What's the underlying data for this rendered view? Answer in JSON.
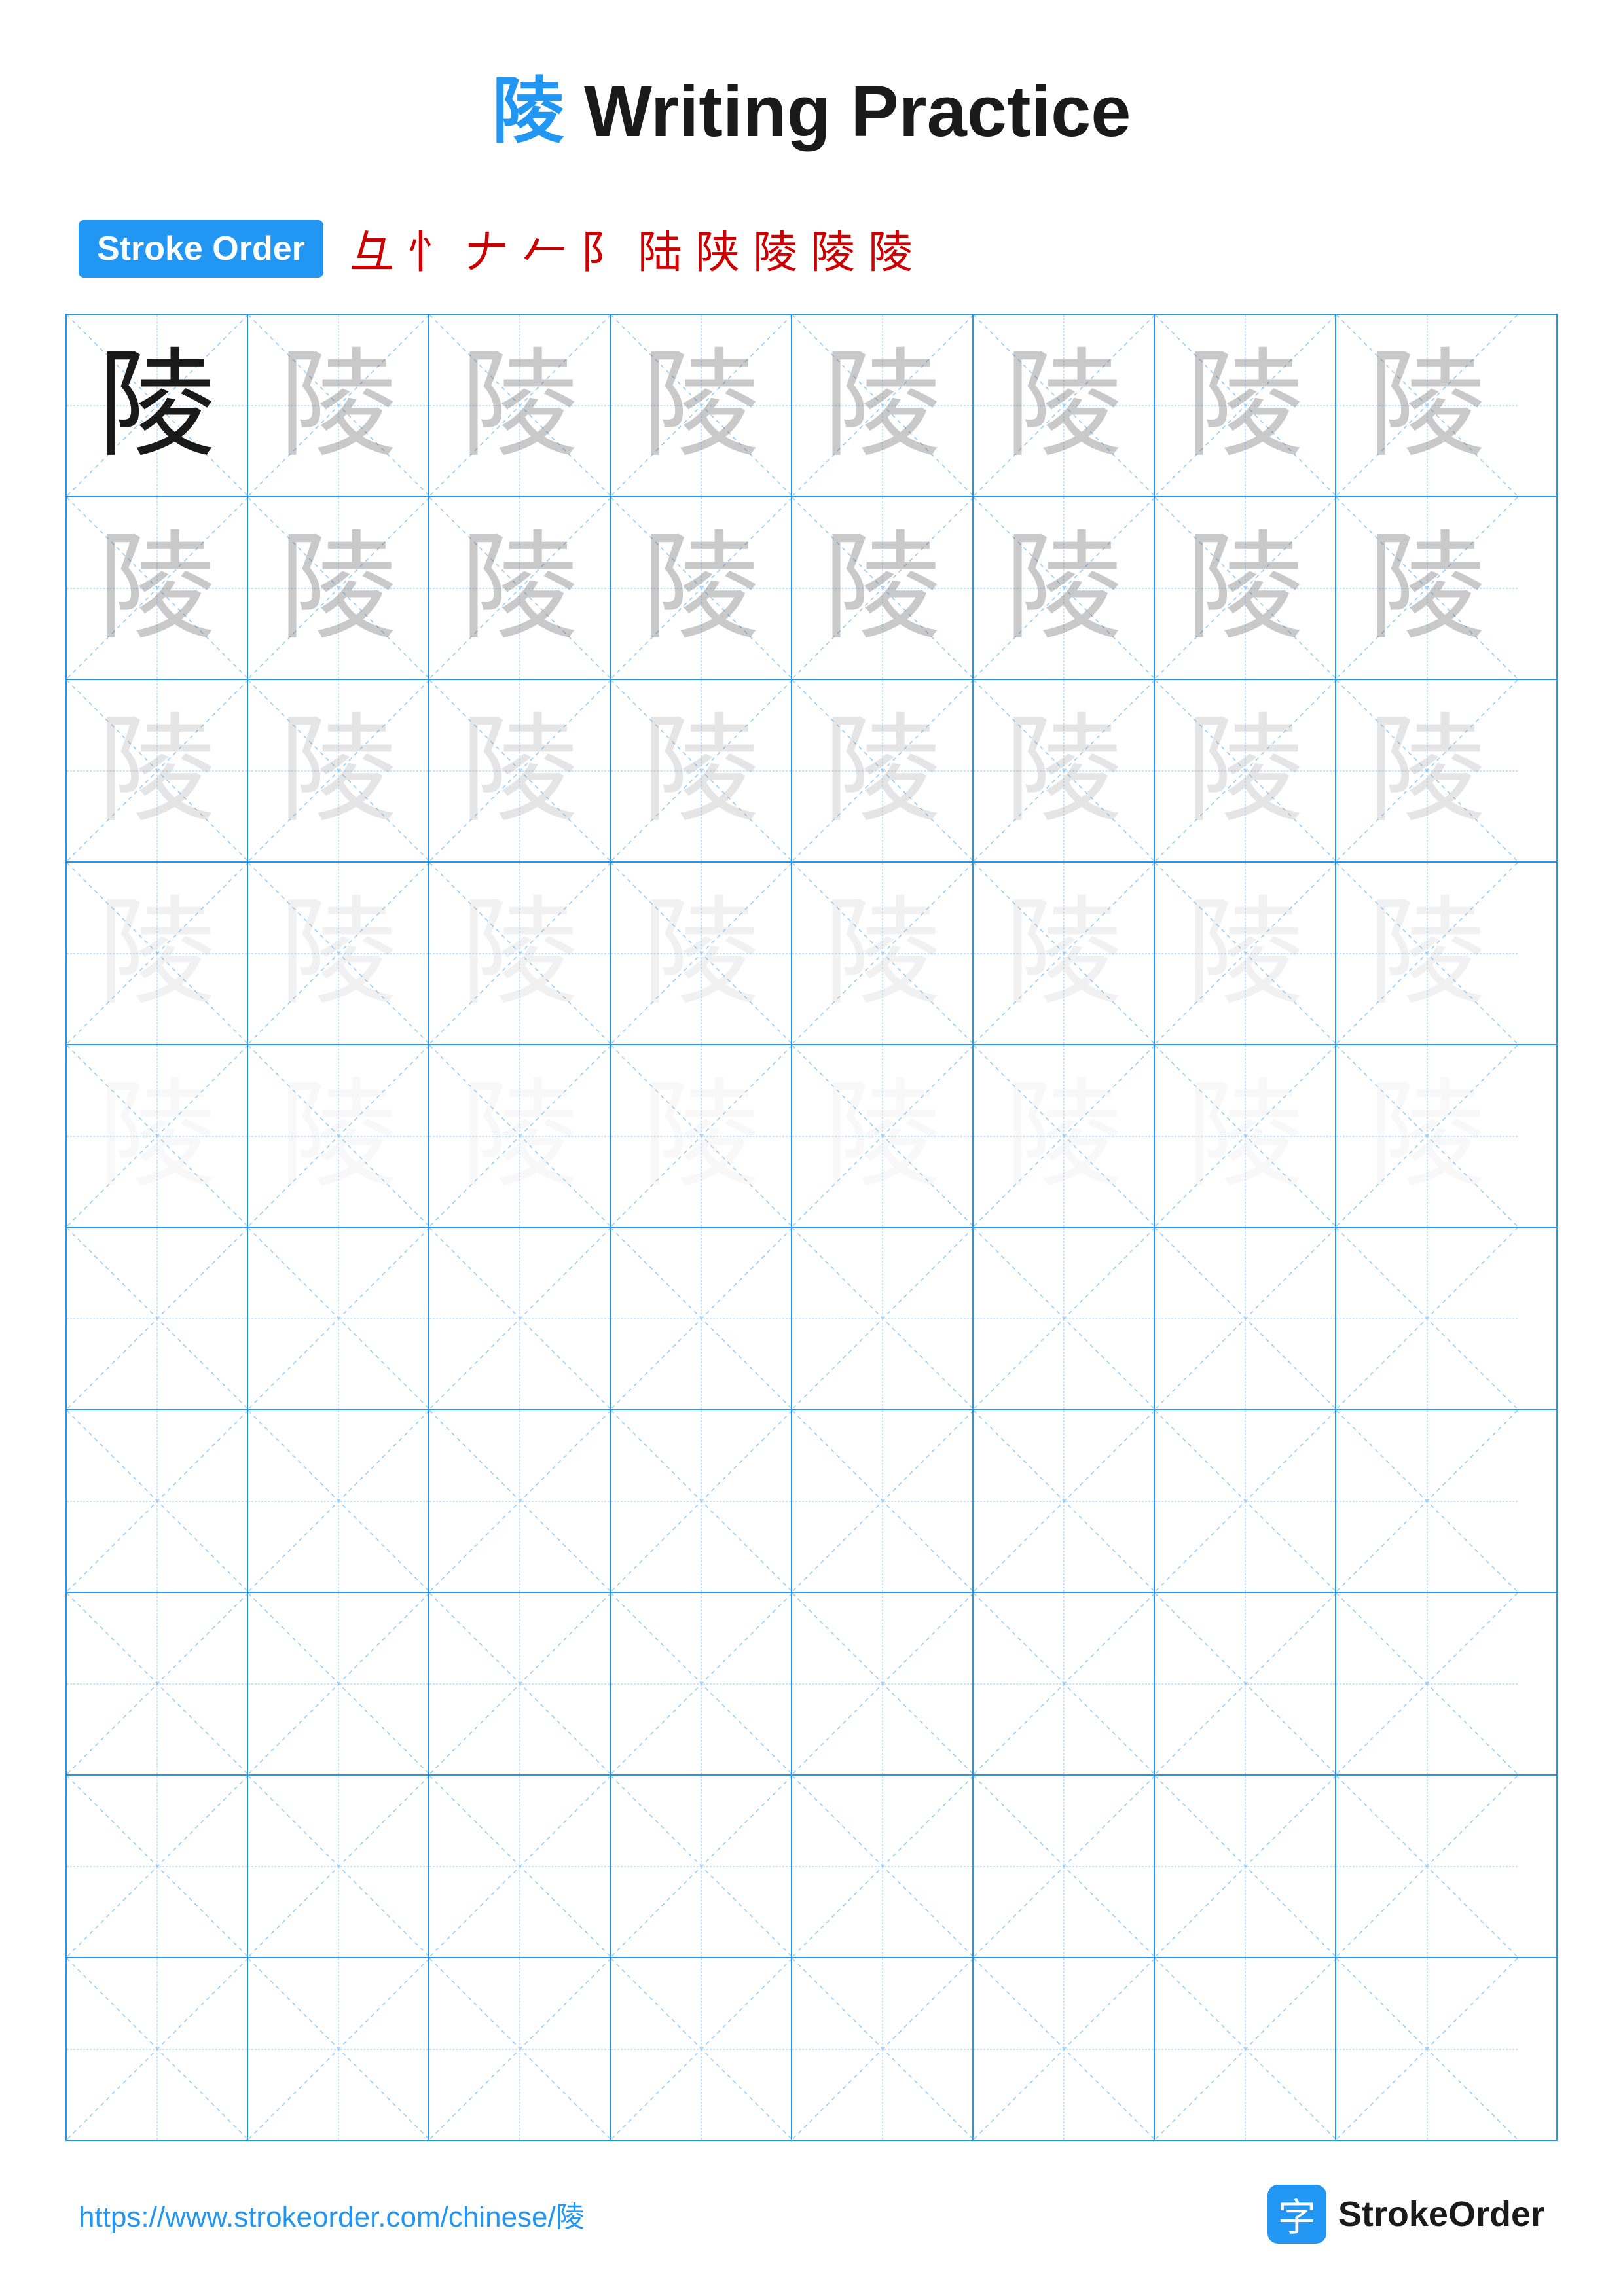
{
  "page": {
    "title_char": "陵",
    "title_text": " Writing Practice"
  },
  "stroke_order": {
    "badge_label": "Stroke Order",
    "steps": [
      "⺔",
      "⺖",
      "⺖⁻",
      "⺖⁺",
      "⺖⊥",
      "陆",
      "陕",
      "陕",
      "陵",
      "陵"
    ]
  },
  "grid": {
    "rows": 10,
    "cols": 8
  },
  "footer": {
    "url": "https://www.strokeorder.com/chinese/陵",
    "logo_icon": "字",
    "logo_text": "StrokeOrder"
  }
}
